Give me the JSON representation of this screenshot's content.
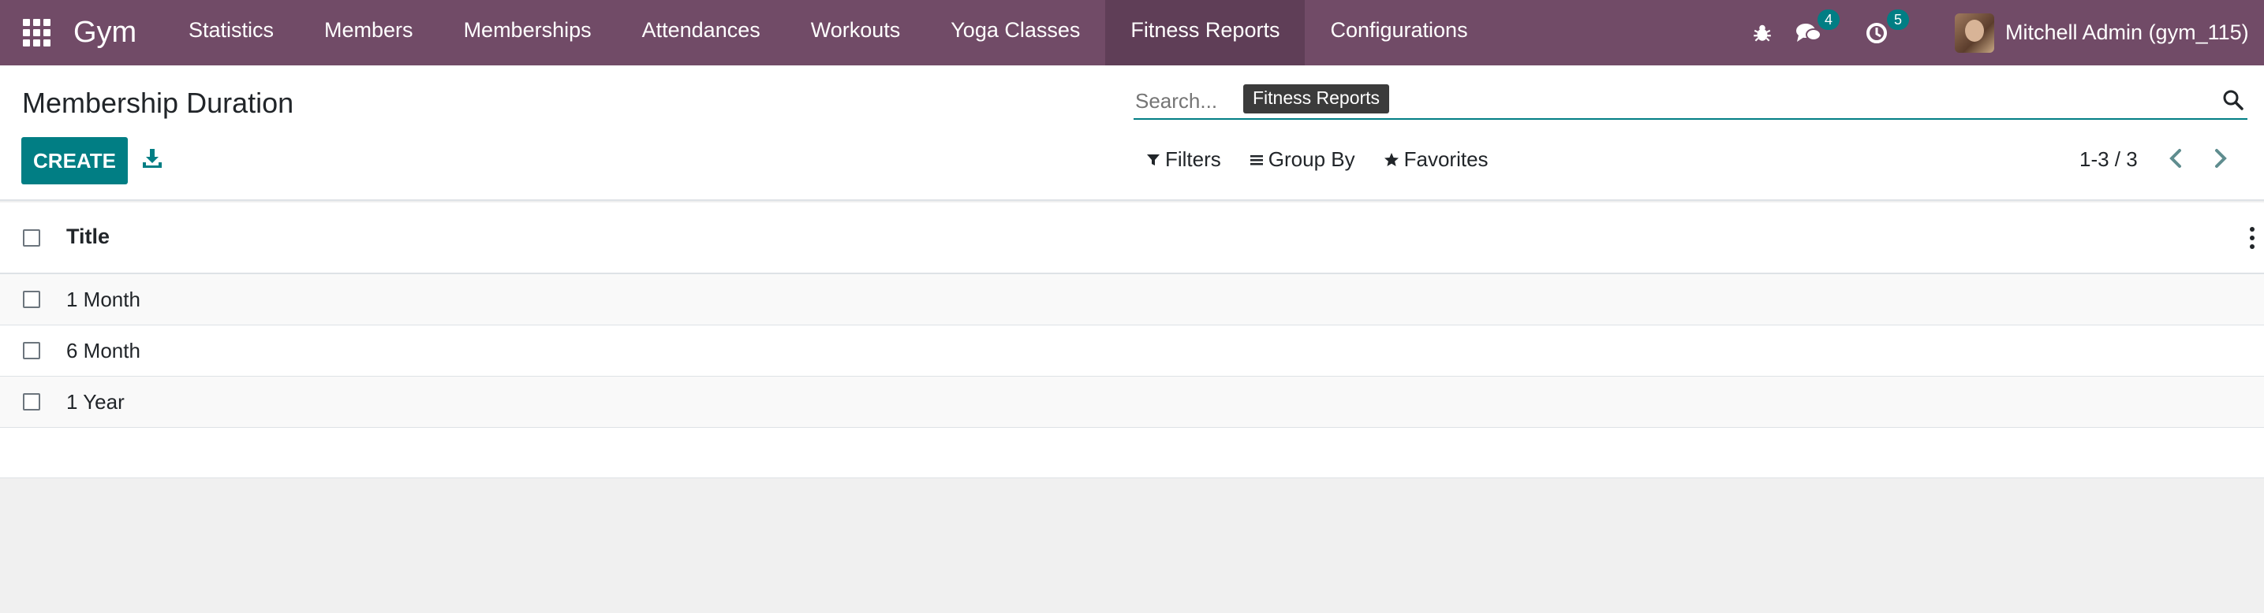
{
  "navbar": {
    "app_name": "Gym",
    "menu": [
      {
        "label": "Statistics"
      },
      {
        "label": "Members"
      },
      {
        "label": "Memberships"
      },
      {
        "label": "Attendances"
      },
      {
        "label": "Workouts"
      },
      {
        "label": "Yoga Classes"
      },
      {
        "label": "Fitness Reports",
        "active": true
      },
      {
        "label": "Configurations"
      }
    ],
    "messages_count": "4",
    "activities_count": "5",
    "user_name": "Mitchell Admin (gym_115)"
  },
  "control_panel": {
    "page_title": "Membership Duration",
    "create_label": "CREATE",
    "search_placeholder": "Search...",
    "tooltip": "Fitness Reports",
    "filters_label": "Filters",
    "group_by_label": "Group By",
    "favorites_label": "Favorites",
    "pager": "1-3 / 3"
  },
  "list": {
    "column_title": "Title",
    "rows": [
      {
        "title": "1 Month"
      },
      {
        "title": "6 Month"
      },
      {
        "title": "1 Year"
      }
    ]
  },
  "colors": {
    "navbar": "#714b67",
    "primary": "#017e84"
  }
}
